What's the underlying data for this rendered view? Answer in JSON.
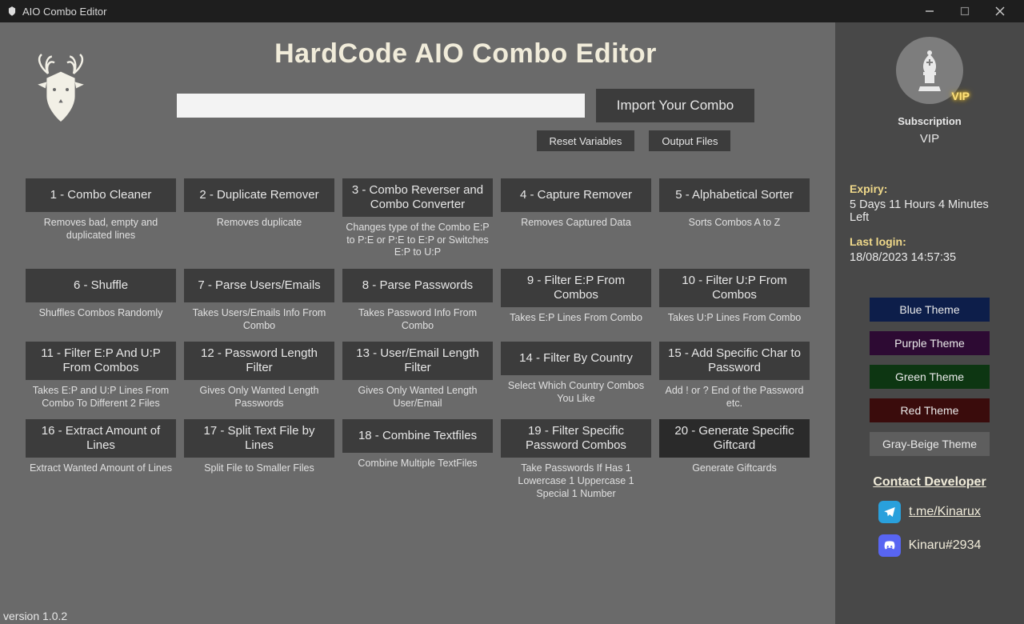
{
  "window": {
    "title": "AIO Combo Editor"
  },
  "header": {
    "title": "HardCode AIO Combo Editor",
    "input_value": "",
    "import_label": "Import Your Combo",
    "reset_label": "Reset Variables",
    "output_label": "Output Files"
  },
  "tools": [
    {
      "label": "1 - Combo Cleaner",
      "desc": "Removes bad, empty and duplicated lines"
    },
    {
      "label": "2 - Duplicate Remover",
      "desc": "Removes duplicate"
    },
    {
      "label": "3 - Combo Reverser and Combo Converter",
      "desc": "Changes type of the Combo E:P to P:E or P:E to E:P or Switches E:P to U:P"
    },
    {
      "label": "4 - Capture Remover",
      "desc": "Removes Captured Data"
    },
    {
      "label": "5 - Alphabetical Sorter",
      "desc": "Sorts Combos A to Z"
    },
    {
      "label": "6 - Shuffle",
      "desc": "Shuffles Combos Randomly"
    },
    {
      "label": "7 - Parse Users/Emails",
      "desc": "Takes Users/Emails Info From Combo"
    },
    {
      "label": "8 - Parse Passwords",
      "desc": "Takes Password Info From Combo"
    },
    {
      "label": "9 - Filter E:P From Combos",
      "desc": "Takes E:P Lines From Combo"
    },
    {
      "label": "10 - Filter U:P From Combos",
      "desc": "Takes U:P Lines From Combo"
    },
    {
      "label": "11 - Filter E:P And U:P From Combos",
      "desc": "Takes E:P and U:P Lines From Combo To Different 2 Files"
    },
    {
      "label": "12 - Password Length Filter",
      "desc": "Gives Only Wanted Length Passwords"
    },
    {
      "label": "13 - User/Email Length Filter",
      "desc": "Gives Only Wanted Length User/Email"
    },
    {
      "label": "14 - Filter By Country",
      "desc": "Select Which Country Combos You Like"
    },
    {
      "label": "15 - Add Specific Char to Password",
      "desc": "Add ! or ? End of the Password etc."
    },
    {
      "label": "16 - Extract Amount of Lines",
      "desc": "Extract Wanted Amount of Lines"
    },
    {
      "label": "17 - Split Text File by Lines",
      "desc": "Split File to Smaller Files"
    },
    {
      "label": "18 - Combine Textfiles",
      "desc": "Combine Multiple TextFiles"
    },
    {
      "label": "19 - Filter Specific Password Combos",
      "desc": "Take Passwords If Has 1 Lowercase 1 Uppercase 1 Special 1 Number"
    },
    {
      "label": "20 - Generate Specific Giftcard",
      "desc": "Generate Giftcards",
      "dark": true
    }
  ],
  "sidebar": {
    "vip_badge": "VIP",
    "subscription_label": "Subscription",
    "subscription_value": "VIP",
    "expiry_label": "Expiry:",
    "expiry_value": "5 Days 11 Hours 4 Minutes Left",
    "last_login_label": "Last login:",
    "last_login_value": "18/08/2023 14:57:35",
    "themes": {
      "blue": "Blue Theme",
      "purple": "Purple Theme",
      "green": "Green Theme",
      "red": "Red Theme",
      "gray": "Gray-Beige Theme"
    },
    "contact_title": "Contact Developer",
    "telegram": "t.me/Kinarux",
    "discord": "Kinaru#2934"
  },
  "footer": {
    "version": "version 1.0.2"
  }
}
